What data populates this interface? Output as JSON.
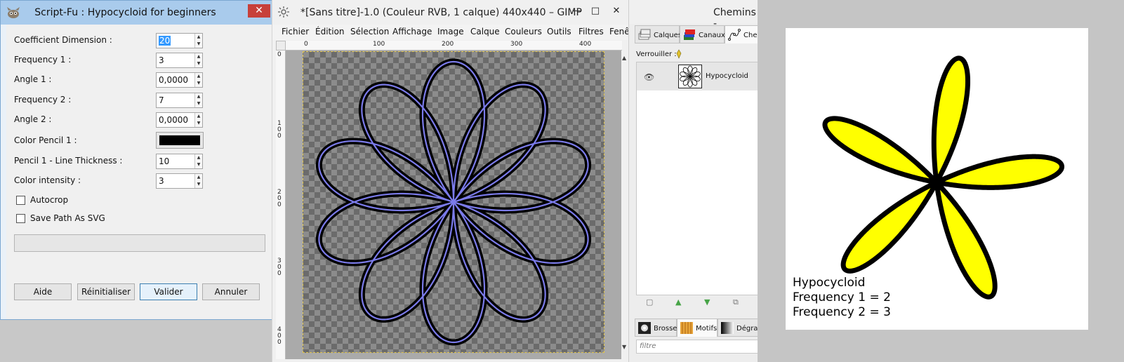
{
  "scriptfu": {
    "title": "Script-Fu : Hypocycloid for beginners",
    "close_symbol": "✕",
    "fields": [
      {
        "label": "Coefficient Dimension :",
        "value": "20",
        "selected": true
      },
      {
        "label": "Frequency 1 :",
        "value": "3"
      },
      {
        "label": "Angle 1 :",
        "value": "0,0000"
      },
      {
        "label": "Frequency 2 :",
        "value": "7"
      },
      {
        "label": "Angle 2 :",
        "value": "0,0000"
      },
      {
        "label": "Color Pencil 1 :",
        "color": "#000000"
      },
      {
        "label": "Pencil 1 - Line Thickness :",
        "value": "10"
      },
      {
        "label": "Color intensity :",
        "value": "3"
      }
    ],
    "checks": [
      {
        "label": "Autocrop",
        "checked": false
      },
      {
        "label": "Save Path As SVG",
        "checked": false
      }
    ],
    "buttons": {
      "help": "Aide",
      "reset": "Réinitialiser",
      "ok": "Valider",
      "cancel": "Annuler"
    }
  },
  "gimp": {
    "title": "*[Sans titre]-1.0 (Couleur RVB, 1 calque) 440x440 – GIMP",
    "window_buttons": {
      "minimize": "—",
      "maximize": "□",
      "close": "✕"
    },
    "menu": [
      "Fichier",
      "Édition",
      "Sélection",
      "Affichage",
      "Image",
      "Calque",
      "Couleurs",
      "Outils",
      "Filtres",
      "Fenêt"
    ],
    "hruler": [
      "0",
      "100",
      "200",
      "300",
      "400"
    ],
    "vruler": [
      "0",
      "100",
      "200",
      "300",
      "400"
    ],
    "stroke_color": "#7b7bea",
    "frequencies": [
      3,
      7
    ]
  },
  "dock": {
    "title": "Chemins -",
    "tabs": [
      "Calques",
      "Canaux",
      "Chem"
    ],
    "lock_label": "Verrouiller :",
    "path_name": "Hypocycloid",
    "bottom_tabs": [
      "Brosses",
      "Motifs",
      "Dégradé"
    ],
    "filter_placeholder": "filtre"
  },
  "result": {
    "fill_color": "#ffff00",
    "caption": [
      "Hypocycloid",
      "Frequency 1  =  2",
      "Frequency 2  =  3"
    ],
    "frequencies": [
      2,
      3
    ]
  }
}
